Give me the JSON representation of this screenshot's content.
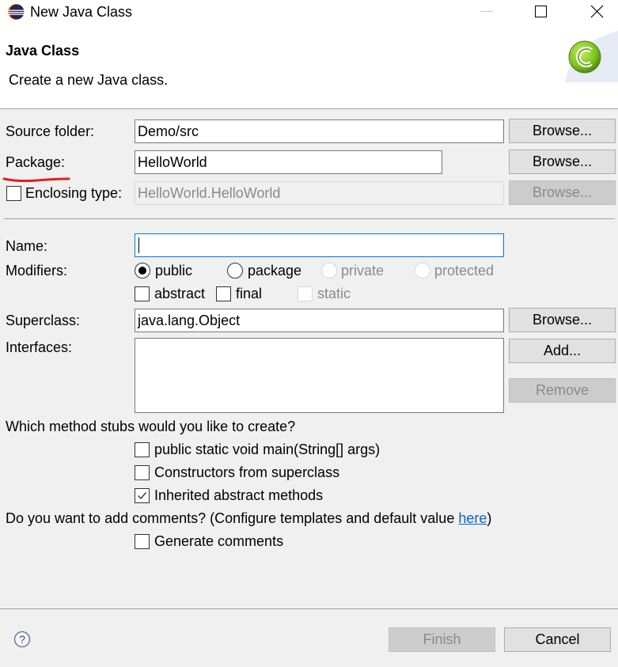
{
  "window": {
    "title": "New Java Class",
    "controls": {
      "minimize": "minimize-icon",
      "maximize": "maximize-icon",
      "close": "close-icon"
    }
  },
  "header": {
    "title": "Java Class",
    "description": "Create a new Java class."
  },
  "form": {
    "source_folder": {
      "label": "Source folder:",
      "value": "Demo/src",
      "button": "Browse..."
    },
    "package": {
      "label": "Package:",
      "value": "HelloWorld",
      "button": "Browse...",
      "annotation_color": "#e02020"
    },
    "enclosing_type": {
      "label": "Enclosing type:",
      "checked": false,
      "value": "HelloWorld.HelloWorld",
      "button": "Browse..."
    },
    "name": {
      "label": "Name:",
      "value": ""
    },
    "modifiers": {
      "label": "Modifiers:",
      "visibility": [
        {
          "label": "public",
          "selected": true,
          "enabled": true
        },
        {
          "label": "package",
          "selected": false,
          "enabled": true
        },
        {
          "label": "private",
          "selected": false,
          "enabled": false
        },
        {
          "label": "protected",
          "selected": false,
          "enabled": false
        }
      ],
      "flags": [
        {
          "label": "abstract",
          "checked": false,
          "enabled": true
        },
        {
          "label": "final",
          "checked": false,
          "enabled": true
        },
        {
          "label": "static",
          "checked": false,
          "enabled": false
        }
      ]
    },
    "superclass": {
      "label": "Superclass:",
      "value": "java.lang.Object",
      "button": "Browse..."
    },
    "interfaces": {
      "label": "Interfaces:",
      "items": [],
      "add_button": "Add...",
      "remove_button": "Remove"
    },
    "stubs": {
      "question": "Which method stubs would you like to create?",
      "options": [
        {
          "label": "public static void main(String[] args)",
          "checked": false
        },
        {
          "label": "Constructors from superclass",
          "checked": false
        },
        {
          "label": "Inherited abstract methods",
          "checked": true
        }
      ]
    },
    "comments": {
      "question_prefix": "Do you want to add comments? (Configure templates and default value ",
      "link": "here",
      "question_suffix": ")",
      "option": {
        "label": "Generate comments",
        "checked": false
      }
    }
  },
  "footer": {
    "help_icon": "help-icon",
    "finish": "Finish",
    "cancel": "Cancel"
  }
}
